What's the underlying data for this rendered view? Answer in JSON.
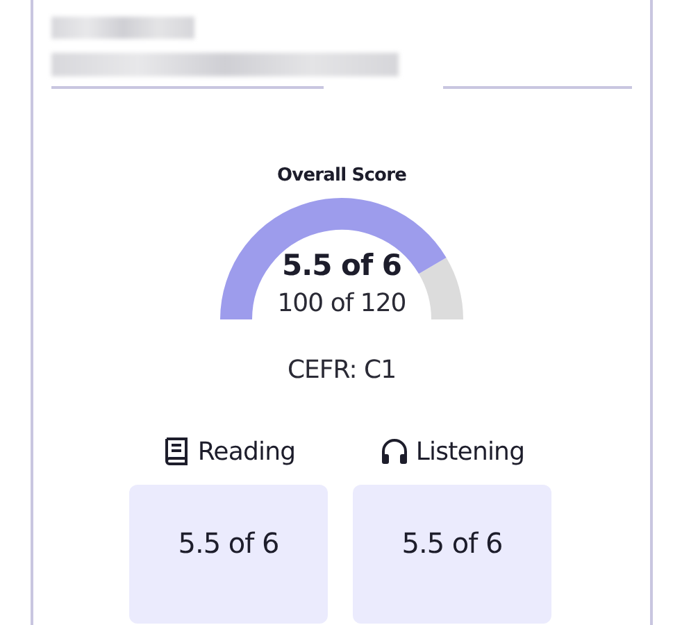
{
  "overall_score": {
    "title": "Overall Score",
    "band_score": "5.5 of 6",
    "raw_score": "100 of 120",
    "cefr": "CEFR: C1"
  },
  "sections": [
    {
      "kind": "reading",
      "label": "Reading",
      "score": "5.5 of 6"
    },
    {
      "kind": "listening",
      "label": "Listening",
      "score": "5.5 of 6"
    }
  ]
}
